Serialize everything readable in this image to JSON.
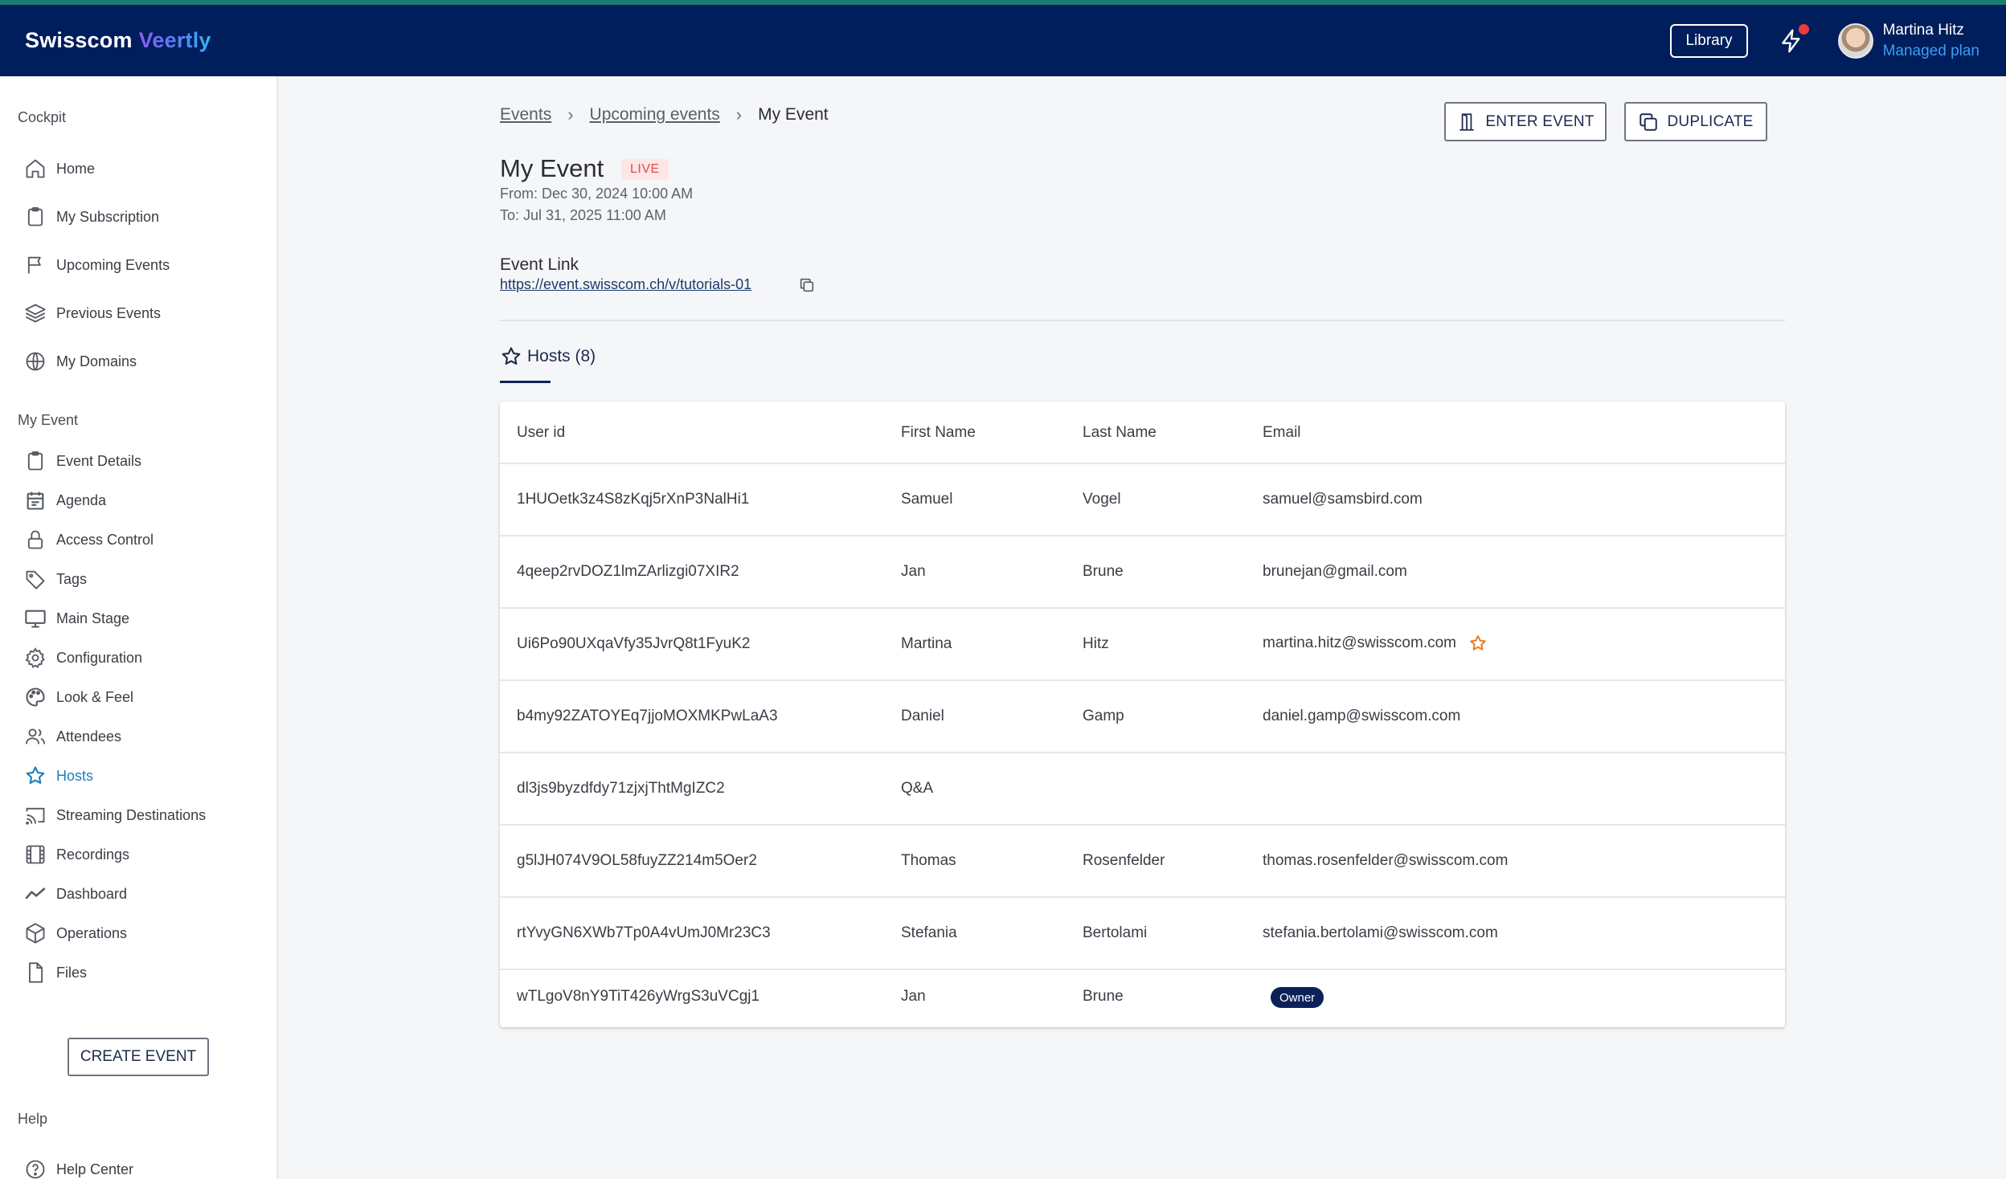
{
  "header": {
    "logo_primary": "Swisscom",
    "logo_secondary": "Veertly",
    "library_label": "Library",
    "user_name": "Martina Hitz",
    "user_plan": "Managed plan"
  },
  "sidebar": {
    "cockpit_title": "Cockpit",
    "cockpit_items": [
      {
        "label": "Home",
        "icon": "home-icon"
      },
      {
        "label": "My Subscription",
        "icon": "clipboard-icon"
      },
      {
        "label": "Upcoming Events",
        "icon": "flag-icon"
      },
      {
        "label": "Previous Events",
        "icon": "layers-icon"
      },
      {
        "label": "My Domains",
        "icon": "globe-icon"
      }
    ],
    "event_title": "My Event",
    "event_items": [
      {
        "label": "Event Details",
        "icon": "clipboard-icon"
      },
      {
        "label": "Agenda",
        "icon": "calendar-icon"
      },
      {
        "label": "Access Control",
        "icon": "lock-icon"
      },
      {
        "label": "Tags",
        "icon": "tag-icon"
      },
      {
        "label": "Main Stage",
        "icon": "monitor-icon"
      },
      {
        "label": "Configuration",
        "icon": "gear-icon"
      },
      {
        "label": "Look & Feel",
        "icon": "palette-icon"
      },
      {
        "label": "Attendees",
        "icon": "users-icon"
      },
      {
        "label": "Hosts",
        "icon": "star-icon",
        "active": true
      },
      {
        "label": "Streaming Destinations",
        "icon": "cast-icon"
      },
      {
        "label": "Recordings",
        "icon": "film-icon"
      },
      {
        "label": "Dashboard",
        "icon": "trend-icon"
      },
      {
        "label": "Operations",
        "icon": "box-icon"
      },
      {
        "label": "Files",
        "icon": "file-icon"
      }
    ],
    "create_event_label": "CREATE EVENT",
    "help_title": "Help",
    "help_items": [
      {
        "label": "Help Center",
        "icon": "help-icon"
      }
    ]
  },
  "breadcrumb": {
    "level1": "Events",
    "level2": "Upcoming events",
    "current": "My Event"
  },
  "actions": {
    "enter_label": "ENTER EVENT",
    "duplicate_label": "DUPLICATE"
  },
  "event": {
    "title": "My Event",
    "status": "LIVE",
    "from": "From: Dec 30, 2024 10:00 AM",
    "to": "To: Jul 31, 2025 11:00 AM",
    "link_label": "Event Link",
    "link_url": "https://event.swisscom.ch/v/tutorials-01"
  },
  "tabs": {
    "hosts_label": "Hosts (8)"
  },
  "table": {
    "headers": {
      "user_id": "User id",
      "first_name": "First Name",
      "last_name": "Last Name",
      "email": "Email"
    },
    "rows": [
      {
        "user_id": "1HUOetk3z4S8zKqj5rXnP3NalHi1",
        "first_name": "Samuel",
        "last_name": "Vogel",
        "email": "samuel@samsbird.com"
      },
      {
        "user_id": "4qeep2rvDOZ1lmZArlizgi07XIR2",
        "first_name": "Jan",
        "last_name": "Brune",
        "email": "brunejan@gmail.com"
      },
      {
        "user_id": "Ui6Po90UXqaVfy35JvrQ8t1FyuK2",
        "first_name": "Martina",
        "last_name": "Hitz",
        "email": "martina.hitz@swisscom.com",
        "starred": true
      },
      {
        "user_id": "b4my92ZATOYEq7jjoMOXMKPwLaA3",
        "first_name": "Daniel",
        "last_name": "Gamp",
        "email": "daniel.gamp@swisscom.com"
      },
      {
        "user_id": "dl3js9byzdfdy71zjxjThtMgIZC2",
        "first_name": "Q&A",
        "last_name": "",
        "email": ""
      },
      {
        "user_id": "g5lJH074V9OL58fuyZZ214m5Oer2",
        "first_name": "Thomas",
        "last_name": "Rosenfelder",
        "email": "thomas.rosenfelder@swisscom.com"
      },
      {
        "user_id": "rtYvyGN6XWb7Tp0A4vUmJ0Mr23C3",
        "first_name": "Stefania",
        "last_name": "Bertolami",
        "email": "stefania.bertolami@swisscom.com"
      },
      {
        "user_id": "wTLgoV8nY9TiT426yWrgS3uVCgj1",
        "first_name": "Jan",
        "last_name": "Brune",
        "email": "",
        "badge": "Owner"
      }
    ]
  },
  "colors": {
    "header_bg": "#001d5c",
    "active_nav": "#1b7fb8",
    "live_badge_bg": "#fde6e6",
    "live_badge_text": "#e24a4a",
    "star_accent": "#ee7b1f",
    "owner_badge_bg": "#0b2157"
  }
}
